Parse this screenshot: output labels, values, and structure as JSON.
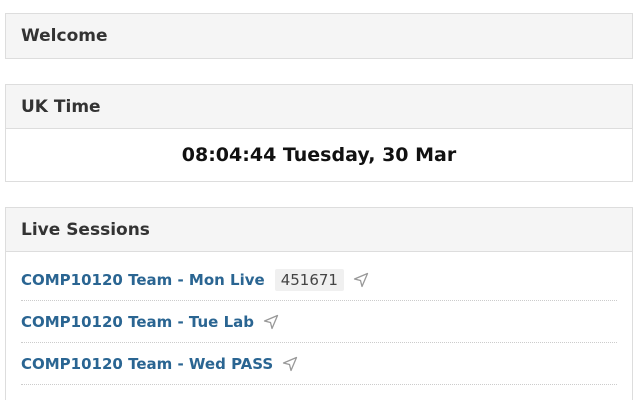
{
  "welcome": {
    "title": "Welcome"
  },
  "uk_time": {
    "title": "UK Time",
    "clock": "08:04:44 Tuesday, 30 Mar"
  },
  "live_sessions": {
    "title": "Live Sessions",
    "items": [
      {
        "label": "COMP10120 Team - Mon Live",
        "code": "451671",
        "icon": "location-arrow-icon"
      },
      {
        "label": "COMP10120 Team - Tue Lab",
        "icon": "location-arrow-icon"
      },
      {
        "label": "COMP10120 Team - Wed PASS",
        "icon": "location-arrow-icon"
      }
    ]
  },
  "colors": {
    "link": "#2a6592",
    "heading_bg": "#f5f5f5",
    "border": "#dddddd"
  }
}
